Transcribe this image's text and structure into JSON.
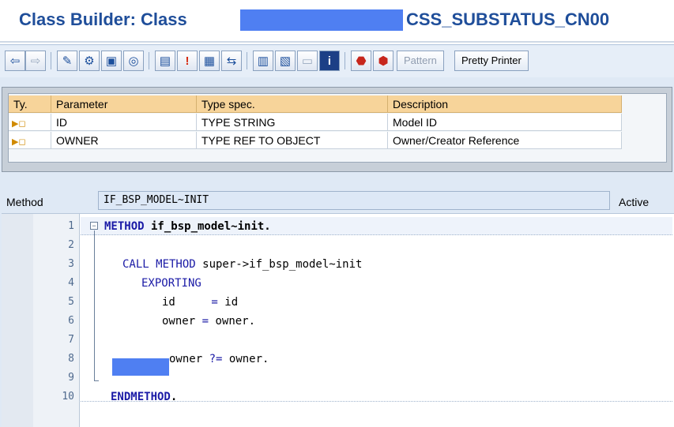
{
  "window": {
    "title_prefix": "Class Builder: Class",
    "title_suffix": "CSS_SUBSTATUS_CN00"
  },
  "toolbar": {
    "buttons": [
      {
        "icon": "back-arrow-icon",
        "glyph": "⇦"
      },
      {
        "icon": "forward-arrow-icon",
        "glyph": "⇨"
      },
      {
        "icon": "edit-pencil-icon",
        "glyph": "✎"
      },
      {
        "icon": "toggle-display-change-icon",
        "glyph": "⚙"
      },
      {
        "icon": "check-icon",
        "glyph": "▣"
      },
      {
        "icon": "activate-icon",
        "glyph": "◎"
      },
      {
        "icon": "object-list-icon",
        "glyph": "▤"
      },
      {
        "icon": "where-used-icon",
        "glyph": "!"
      },
      {
        "icon": "display-object-list-icon",
        "glyph": "▦"
      },
      {
        "icon": "navigate-icon",
        "glyph": "⇆"
      },
      {
        "icon": "hierarchy-icon",
        "glyph": "▥"
      },
      {
        "icon": "structure-icon",
        "glyph": "▧"
      },
      {
        "icon": "blank-field-icon",
        "glyph": "▭"
      },
      {
        "icon": "info-icon",
        "glyph": "i"
      },
      {
        "icon": "sign-icon",
        "glyph": "⬣"
      },
      {
        "icon": "stop-icon",
        "glyph": "⬢"
      }
    ],
    "pattern_label": "Pattern",
    "pretty_printer_label": "Pretty Printer"
  },
  "params": {
    "headers": [
      "Ty.",
      "Parameter",
      "Type spec.",
      "Description"
    ],
    "rows": [
      {
        "ty_icon": "importing-param-icon",
        "parameter": "ID",
        "type_spec": "TYPE STRING",
        "description": "Model ID"
      },
      {
        "ty_icon": "importing-param-icon",
        "parameter": "OWNER",
        "type_spec": "TYPE REF TO OBJECT",
        "description": "Owner/Creator Reference"
      }
    ]
  },
  "method": {
    "label": "Method",
    "name": "IF_BSP_MODEL~INIT",
    "status": "Active"
  },
  "editor": {
    "line_numbers": [
      "1",
      "2",
      "3",
      "4",
      "5",
      "6",
      "7",
      "8",
      "9",
      "10"
    ],
    "lines": {
      "l1_kw": "METHOD",
      "l1_rest": " if_bsp_model~init.",
      "l3_kw": "CALL METHOD",
      "l3_rest": " super->if_bsp_model~init",
      "l4_kw": "EXPORTING",
      "l5_lhs": "id",
      "l5_eq": "=",
      "l5_rhs": "id",
      "l6_lhs": "owner",
      "l6_eq": "=",
      "l6_rhs": "owner.",
      "l8_lhs": "owner",
      "l8_op": "?=",
      "l8_rhs": "owner.",
      "l10_kw": "ENDMETHOD",
      "l10_dot": "."
    }
  }
}
